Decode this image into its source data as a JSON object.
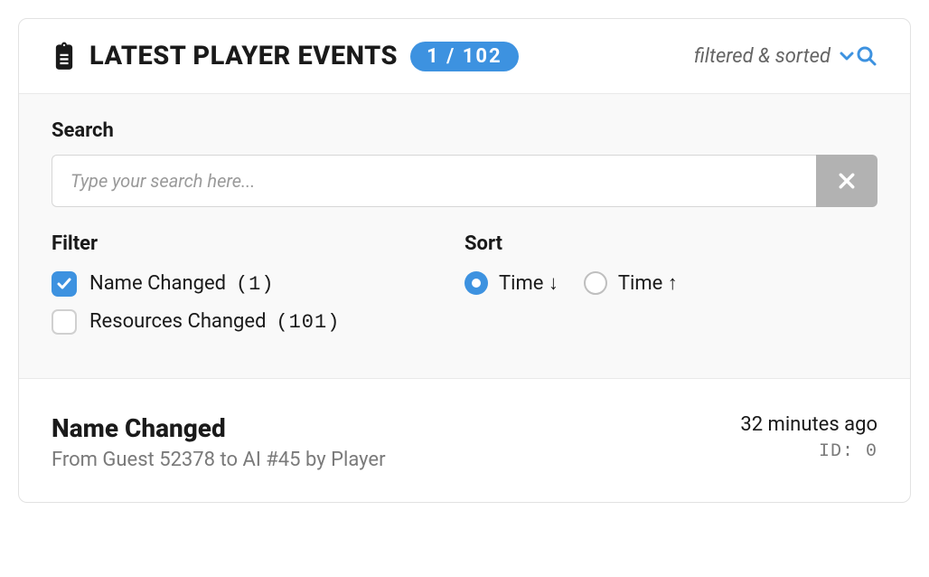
{
  "header": {
    "title": "LATEST PLAYER EVENTS",
    "badge": "1 / 102",
    "status": "filtered & sorted"
  },
  "search": {
    "label": "Search",
    "placeholder": "Type your search here...",
    "value": ""
  },
  "filter": {
    "label": "Filter",
    "options": [
      {
        "label": "Name Changed",
        "count": "(1)",
        "checked": true
      },
      {
        "label": "Resources Changed",
        "count": "(101)",
        "checked": false
      }
    ]
  },
  "sort": {
    "label": "Sort",
    "options": [
      {
        "label": "Time ↓",
        "selected": true
      },
      {
        "label": "Time ↑",
        "selected": false
      }
    ]
  },
  "event": {
    "title": "Name Changed",
    "description": "From Guest 52378 to AI #45 by Player",
    "time": "32 minutes ago",
    "id": "ID: 0"
  }
}
